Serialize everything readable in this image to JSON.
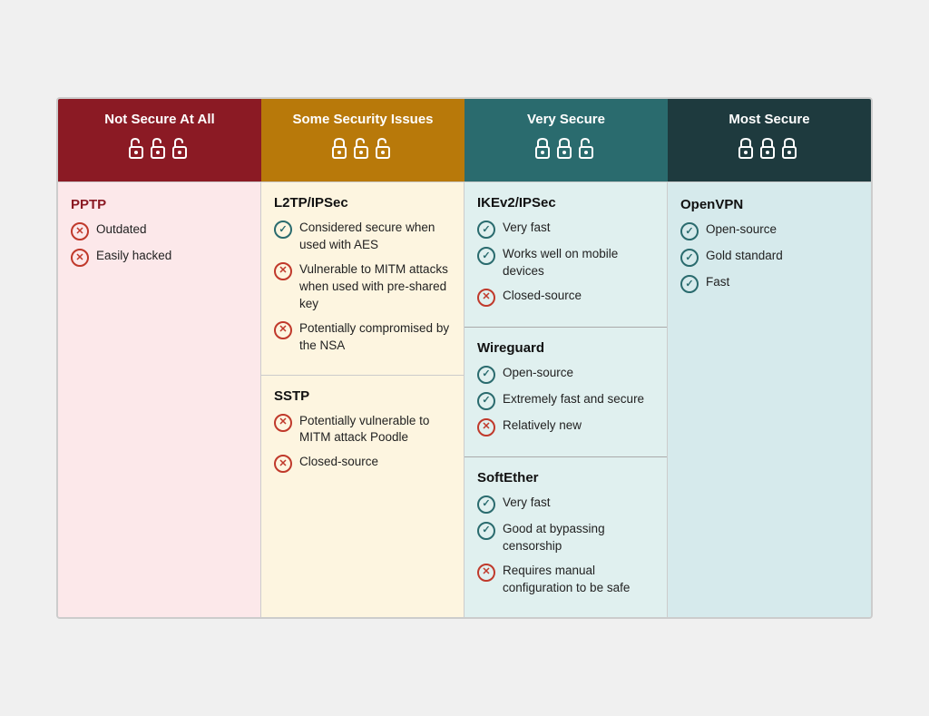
{
  "headers": [
    {
      "id": "not-secure",
      "label": "Not Secure At All",
      "class": "not-secure",
      "locks": "🔓🔓🔓",
      "lock_display": "bad"
    },
    {
      "id": "some-security",
      "label": "Some Security Issues",
      "class": "some-security",
      "locks": "🔒🔓🔓",
      "lock_display": "mixed"
    },
    {
      "id": "very-secure",
      "label": "Very Secure",
      "class": "very-secure",
      "locks": "🔒🔒🔓",
      "lock_display": "good"
    },
    {
      "id": "most-secure",
      "label": "Most Secure",
      "class": "most-secure",
      "locks": "🔒🔒🔒",
      "lock_display": "best"
    }
  ],
  "not_secure": {
    "protocol": "PPTP",
    "features": [
      {
        "type": "cross",
        "text": "Outdated"
      },
      {
        "type": "cross",
        "text": "Easily hacked"
      }
    ]
  },
  "some_security": [
    {
      "protocol": "L2TP/IPSec",
      "features": [
        {
          "type": "check",
          "text": "Considered secure when used with AES"
        },
        {
          "type": "cross",
          "text": "Vulnerable to MITM attacks when used with pre-shared key"
        },
        {
          "type": "cross",
          "text": "Potentially compromised by the NSA"
        }
      ]
    },
    {
      "protocol": "SSTP",
      "features": [
        {
          "type": "cross",
          "text": "Potentially vulnerable to MITM attack Poodle"
        },
        {
          "type": "cross",
          "text": "Closed-source"
        }
      ]
    }
  ],
  "very_secure": [
    {
      "protocol": "IKEv2/IPSec",
      "features": [
        {
          "type": "check",
          "text": "Very fast"
        },
        {
          "type": "check",
          "text": "Works well on mobile devices"
        },
        {
          "type": "cross",
          "text": "Closed-source"
        }
      ]
    },
    {
      "protocol": "Wireguard",
      "features": [
        {
          "type": "check",
          "text": "Open-source"
        },
        {
          "type": "check",
          "text": "Extremely fast and secure"
        },
        {
          "type": "cross",
          "text": "Relatively new"
        }
      ]
    },
    {
      "protocol": "SoftEther",
      "features": [
        {
          "type": "check",
          "text": "Very fast"
        },
        {
          "type": "check",
          "text": "Good at bypassing censorship"
        },
        {
          "type": "cross",
          "text": "Requires manual configuration to be safe"
        }
      ]
    }
  ],
  "most_secure": {
    "protocol": "OpenVPN",
    "features": [
      {
        "type": "check",
        "text": "Open-source"
      },
      {
        "type": "check",
        "text": "Gold standard"
      },
      {
        "type": "check",
        "text": "Fast"
      }
    ]
  }
}
